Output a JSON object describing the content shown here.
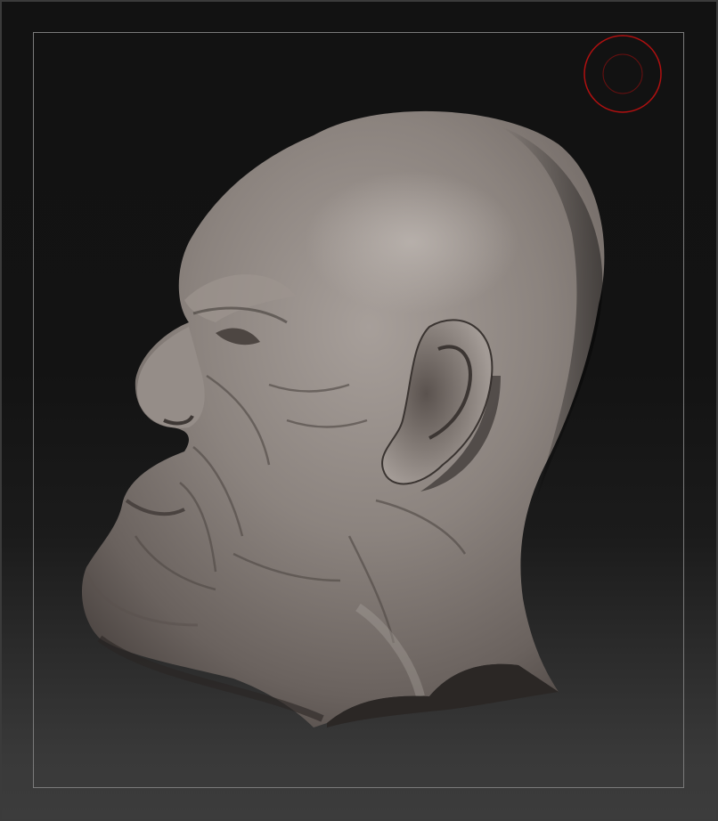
{
  "viewport": {
    "background_top": "#121212",
    "background_bottom": "#3c3c3c",
    "frame_color": "#7a7a7a"
  },
  "model": {
    "subject": "sculpted-head-profile",
    "clay_color": "#8a817c",
    "clay_highlight": "#b3aca7",
    "clay_shadow": "#4a4340"
  },
  "brush_cursor": {
    "outer_ring_color": "#b01010",
    "inner_ring_color": "#6a1010"
  }
}
